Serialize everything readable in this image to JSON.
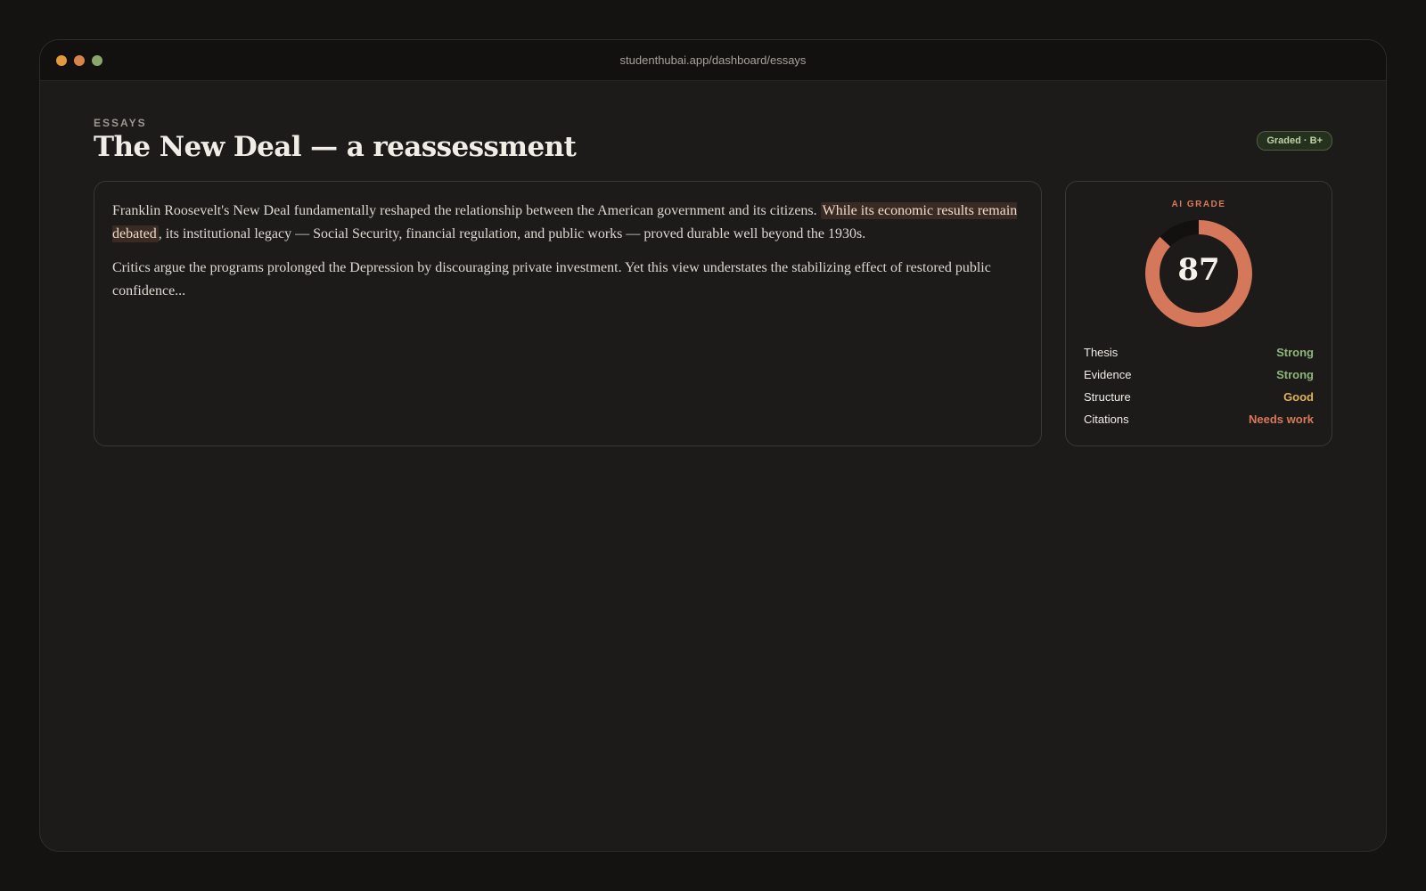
{
  "browser": {
    "url": "studenthubai.app/dashboard/essays"
  },
  "page": {
    "eyebrow": "ESSAYS",
    "title": "The New Deal — a reassessment",
    "badge": "Graded · B+"
  },
  "essay": {
    "p1_before": "Franklin Roosevelt's New Deal fundamentally reshaped the relationship between the American government and its citizens. ",
    "p1_highlight": "While its economic results remain debated",
    "p1_after": ", its institutional legacy — Social Security, financial regulation, and public works — proved durable well beyond the 1930s.",
    "p2": "Critics argue the programs prolonged the Depression by discouraging private investment. Yet this view understates the stabilizing effect of restored public confidence..."
  },
  "grade": {
    "label": "AI GRADE",
    "score": "87",
    "score_fraction": 0.87,
    "ring_color": "#d4775a",
    "criteria": [
      {
        "name": "Thesis",
        "value": "Strong",
        "color": "#8fb57a"
      },
      {
        "name": "Evidence",
        "value": "Strong",
        "color": "#8fb57a"
      },
      {
        "name": "Structure",
        "value": "Good",
        "color": "#e0b256"
      },
      {
        "name": "Citations",
        "value": "Needs work",
        "color": "#d9785a"
      }
    ]
  }
}
